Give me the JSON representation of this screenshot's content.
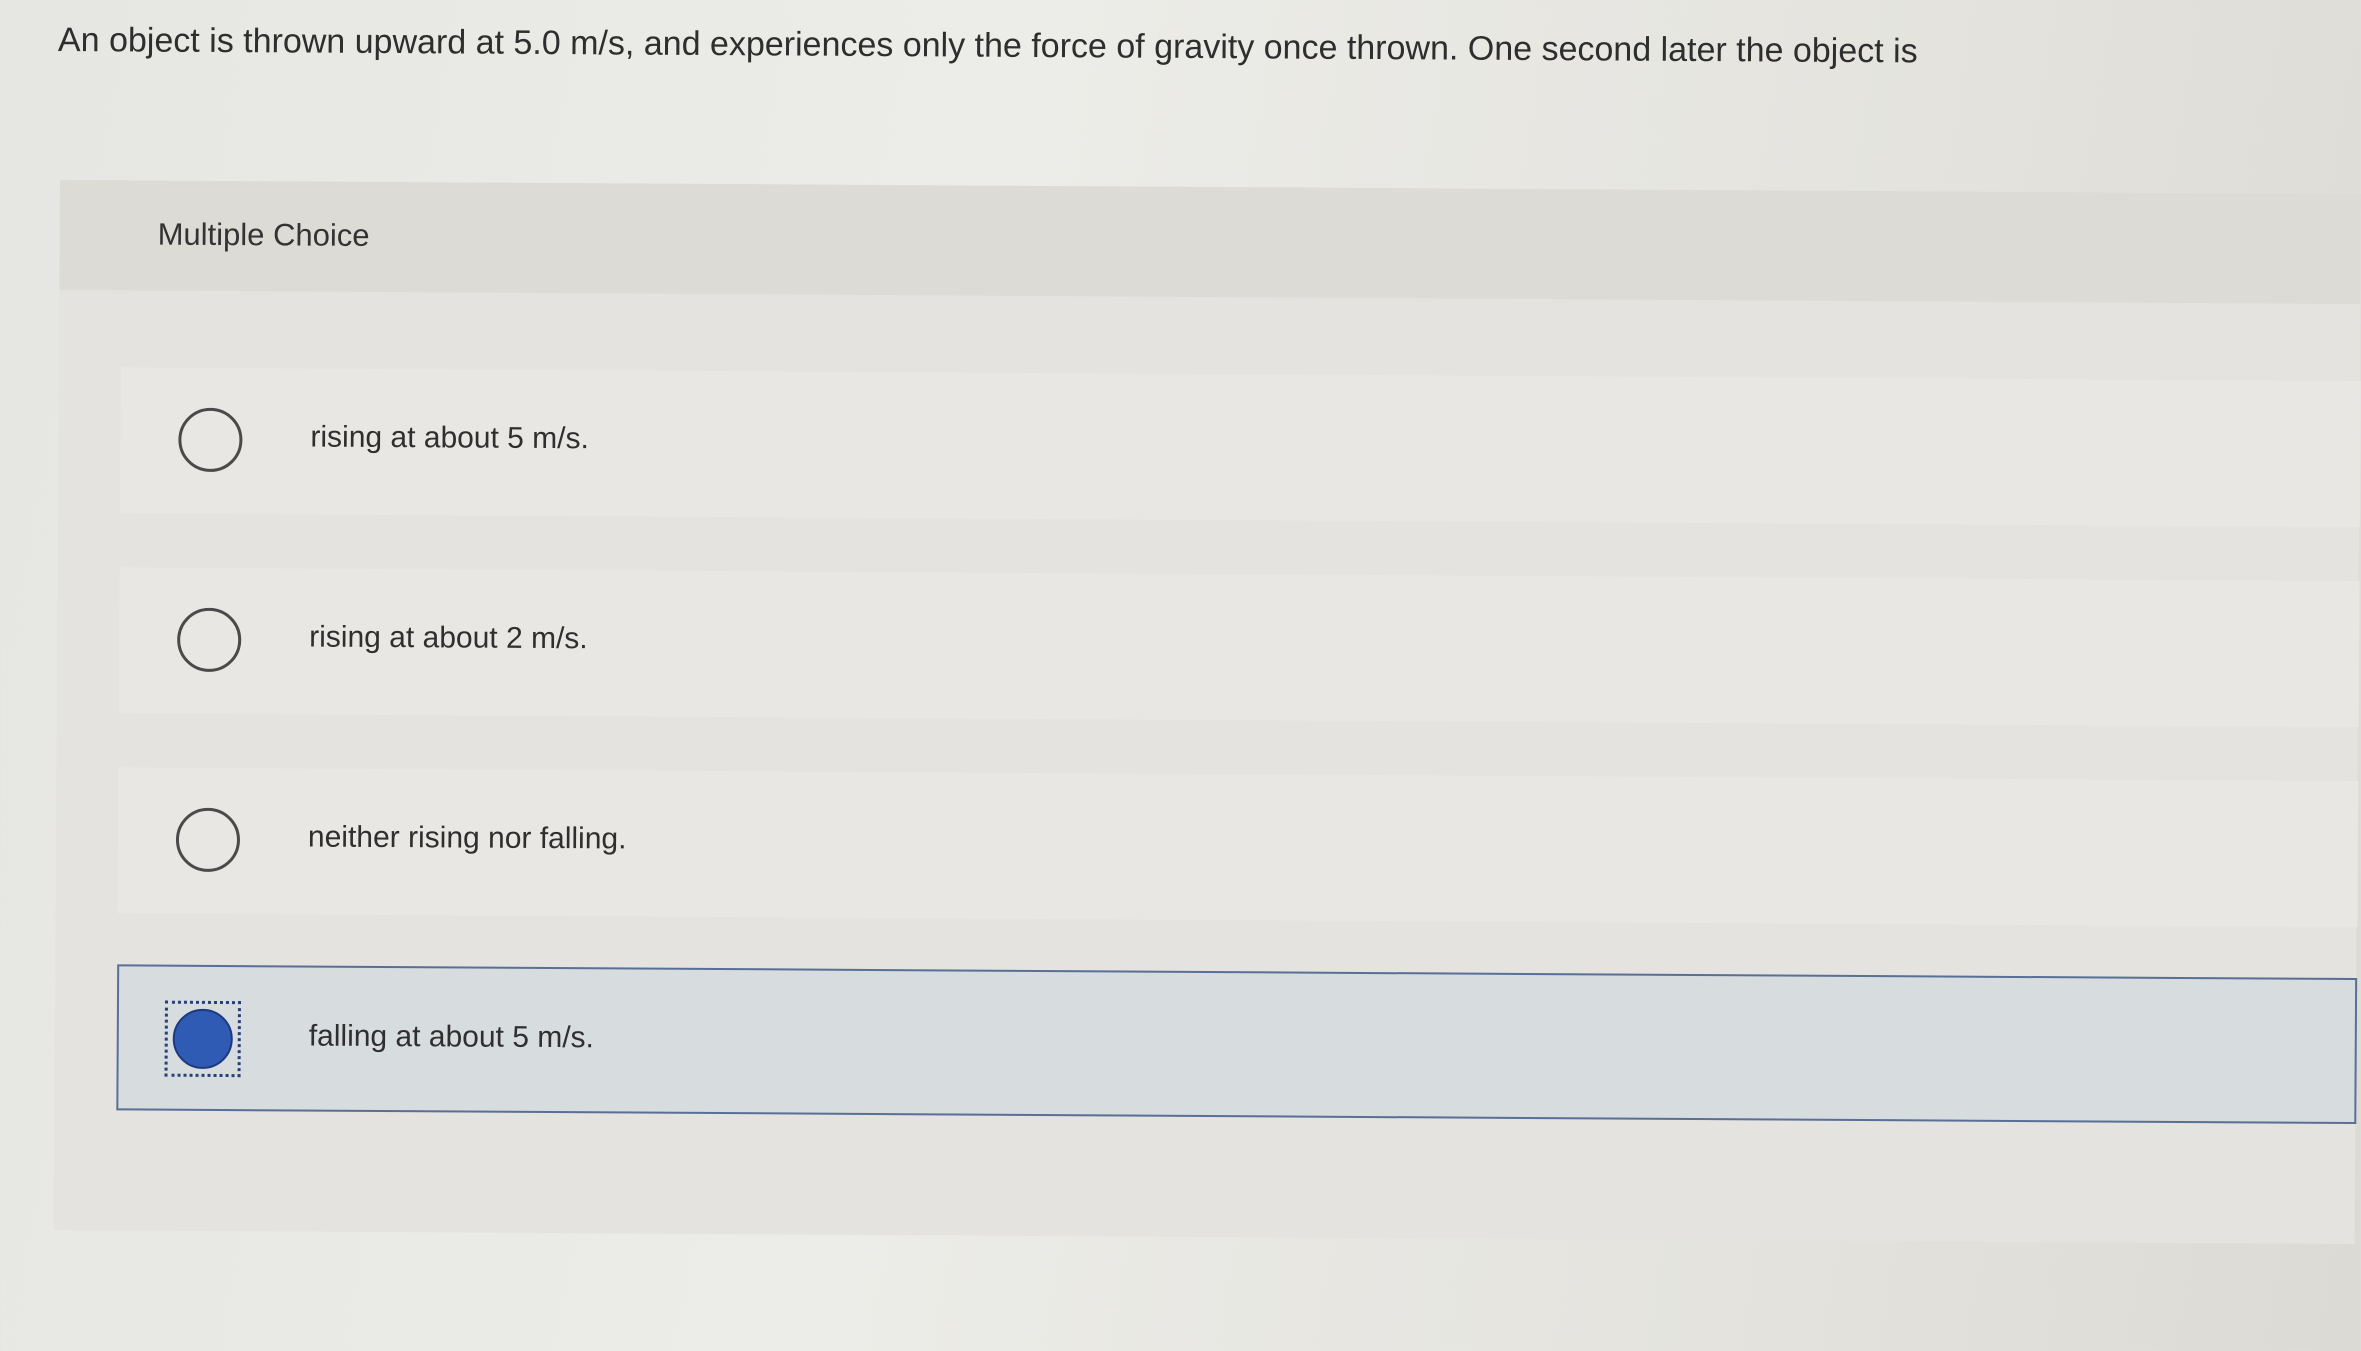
{
  "question": {
    "text": "An object is thrown upward at 5.0 m/s, and experiences only the force of gravity once thrown. One second later the object is"
  },
  "panel": {
    "title": "Multiple Choice"
  },
  "options": [
    {
      "label": "rising at about 5 m/s.",
      "selected": false
    },
    {
      "label": "rising at about 2 m/s.",
      "selected": false
    },
    {
      "label": "neither rising nor falling.",
      "selected": false
    },
    {
      "label": "falling at about 5 m/s.",
      "selected": true
    }
  ],
  "colors": {
    "selected_radio": "#2f5bb5",
    "selected_border": "#5a6f95"
  }
}
